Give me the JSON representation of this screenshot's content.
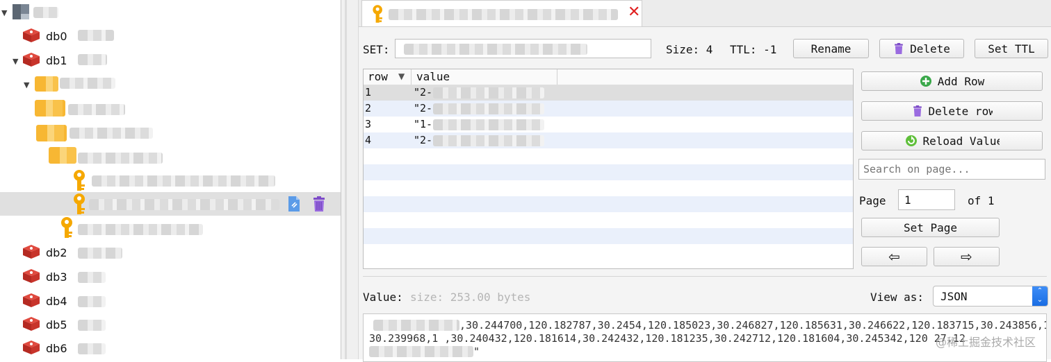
{
  "tree": {
    "databases": [
      {
        "label": "db0"
      },
      {
        "label": "db1"
      },
      {
        "label": "db2"
      },
      {
        "label": "db3"
      },
      {
        "label": "db4"
      },
      {
        "label": "db5"
      },
      {
        "label": "db6"
      }
    ]
  },
  "tab": {
    "close_glyph": "✕"
  },
  "key_header": {
    "type_label": "SET:",
    "size_text": "Size: 4",
    "ttl_text": "TTL: -1",
    "rename_label": "Rename",
    "delete_label": "Delete",
    "set_ttl_label": "Set TTL"
  },
  "table": {
    "columns": [
      "row",
      "value"
    ],
    "rows": [
      {
        "row": "1",
        "prefix": "\"2-"
      },
      {
        "row": "2",
        "prefix": "\"2-"
      },
      {
        "row": "3",
        "prefix": "\"1-"
      },
      {
        "row": "4",
        "prefix": "\"2-"
      }
    ]
  },
  "side": {
    "add_row_label": "Add Row",
    "delete_row_label": "Delete row",
    "reload_label": "Reload Value",
    "search_placeholder": "Search on page...",
    "page_label": "Page",
    "page_value": "1",
    "of_label": "of 1",
    "set_page_label": "Set Page",
    "prev_glyph": "⇦",
    "next_glyph": "⇨"
  },
  "value_section": {
    "label": "Value:",
    "size_text": "size: 253.00 bytes",
    "view_as_label": "View as:",
    "view_as_value": "JSON",
    "line1": ",30.244700,120.182787,30.2454,120.185023,30.246827,120.185631,30.246622,120.183715,30.243856,120.181085,",
    "line2": "30.239968,1        ,30.240432,120.181614,30.242432,120.181235,30.242712,120.181604,30.245342,120          27.12",
    "line3": "\""
  },
  "watermark": "@稀土掘金技术社区",
  "colors": {
    "accent": "#1a6de3",
    "danger": "#e02020",
    "redis_red": "#d62e2e",
    "key_gold": "#f5a800"
  }
}
